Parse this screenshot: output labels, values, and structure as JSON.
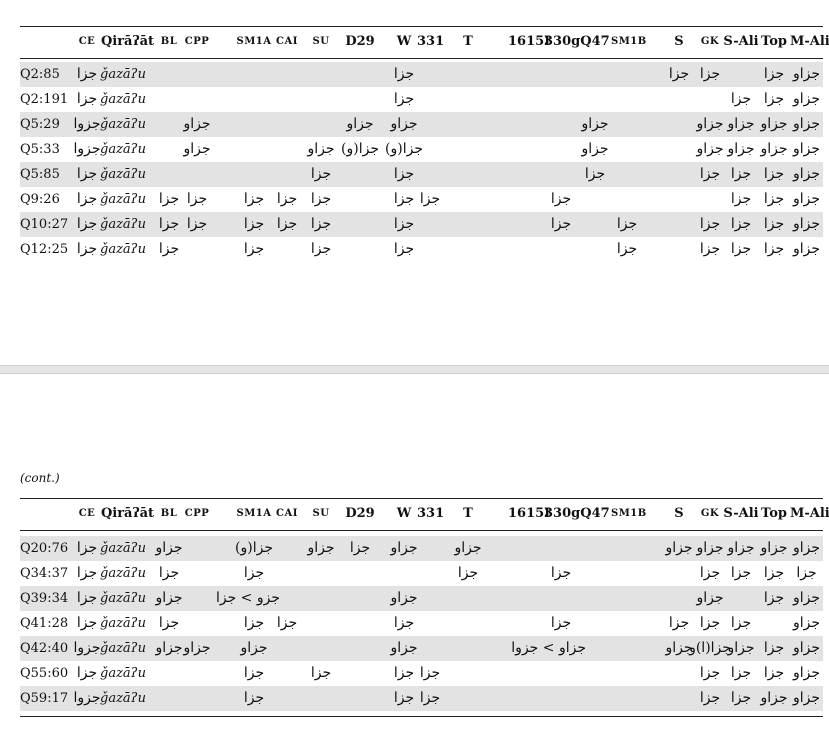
{
  "columns": [
    {
      "key": "ref",
      "label": ""
    },
    {
      "key": "ce",
      "label": "ce"
    },
    {
      "key": "qiraat",
      "label": "Qirāʔāt"
    },
    {
      "key": "bl",
      "label": "bl"
    },
    {
      "key": "cpp",
      "label": "cpp"
    },
    {
      "key": "sm1a",
      "label": "sm1a"
    },
    {
      "key": "cai",
      "label": "cai"
    },
    {
      "key": "su",
      "label": "su"
    },
    {
      "key": "d29",
      "label": "D29"
    },
    {
      "key": "w",
      "label": "W"
    },
    {
      "key": "c331",
      "label": "331"
    },
    {
      "key": "t",
      "label": "T"
    },
    {
      "key": "c1615",
      "label": "1615I"
    },
    {
      "key": "c330",
      "label": "330g"
    },
    {
      "key": "q47",
      "label": "Q47"
    },
    {
      "key": "sm1b",
      "label": "sm1b"
    },
    {
      "key": "s",
      "label": "S"
    },
    {
      "key": "gk",
      "label": "gk"
    },
    {
      "key": "sali",
      "label": "S-Ali"
    },
    {
      "key": "top",
      "label": "Top"
    },
    {
      "key": "mali",
      "label": "M-Ali"
    }
  ],
  "table1": {
    "rows": [
      {
        "ref": "Q2:85",
        "ce": "جزا",
        "qiraat": "ǧazāʔu",
        "w": "جزا",
        "s": "جزا",
        "gk": "جزا",
        "top": "جزا",
        "mali": "جزاو"
      },
      {
        "ref": "Q2:191",
        "ce": "جزا",
        "qiraat": "ǧazāʔu",
        "w": "جزا",
        "sali": "جزا",
        "top": "جزا",
        "mali": "جزاو"
      },
      {
        "ref": "Q5:29",
        "ce": "جزوا",
        "qiraat": "ǧazāʔu",
        "cpp": "جزاو",
        "d29": "جزاو",
        "w": "جزاو",
        "q47": "جزاو",
        "gk": "جزاو",
        "sali": "جزاو",
        "top": "جزاو",
        "mali": "جزاو"
      },
      {
        "ref": "Q5:33",
        "ce": "جزوا",
        "qiraat": "ǧazāʔu",
        "cpp": "جزاو",
        "su": "جزاو",
        "d29": "جزا(و)",
        "w": "جزا(و)",
        "q47": "جزاو",
        "gk": "جزاو",
        "sali": "جزاو",
        "top": "جزاو",
        "mali": "جزاو"
      },
      {
        "ref": "Q5:85",
        "ce": "جزا",
        "qiraat": "ǧazāʔu",
        "su": "جزا",
        "w": "جزا",
        "q47": "جزا",
        "gk": "جزا",
        "sali": "جزا",
        "top": "جزا",
        "mali": "جزاو"
      },
      {
        "ref": "Q9:26",
        "ce": "جزا",
        "qiraat": "ǧazāʔu",
        "bl": "جزا",
        "cpp": "جزا",
        "sm1a": "جزا",
        "cai": "جزا",
        "su": "جزا",
        "w": "جزا",
        "c331": "جزا",
        "c330": "جزا",
        "sali": "جزا",
        "top": "جزا",
        "mali": "جزاو"
      },
      {
        "ref": "Q10:27",
        "ce": "جزا",
        "qiraat": "ǧazāʔu",
        "bl": "جزا",
        "cpp": "جزا",
        "sm1a": "جزا",
        "cai": "جزا",
        "su": "جزا",
        "w": "جزا",
        "c330": "جزا",
        "sm1b": "جزا",
        "gk": "جزا",
        "sali": "جزا",
        "top": "جزا",
        "mali": "جزاو"
      },
      {
        "ref": "Q12:25",
        "ce": "جزا",
        "qiraat": "ǧazāʔu",
        "bl": "جزا",
        "sm1a": "جزا",
        "su": "جزا",
        "w": "جزا",
        "sm1b": "جزا",
        "gk": "جزا",
        "sali": "جزا",
        "top": "جزا",
        "mali": "جزاو"
      }
    ]
  },
  "continuation_label": "(cont.)",
  "table2": {
    "rows": [
      {
        "ref": "Q20:76",
        "ce": "جزا",
        "qiraat": "ǧazāʔu",
        "bl": "جزاو",
        "sm1a": "جزا(و)",
        "su": "جزاو",
        "d29": "جزا",
        "w": "جزاو",
        "t": "جزاو",
        "s": "جزاو",
        "gk": "جزاو",
        "sali": "جزاو",
        "top": "جزاو",
        "mali": "جزاو"
      },
      {
        "ref": "Q34:37",
        "ce": "جزا",
        "qiraat": "ǧazāʔu",
        "bl": "جزا",
        "sm1a": "جزا",
        "t": "جزا",
        "c330": "جزا",
        "gk": "جزا",
        "sali": "جزا",
        "top": "جزا",
        "mali": "جزا"
      },
      {
        "ref": "Q39:34",
        "ce": "جزا",
        "qiraat": "ǧazāʔu",
        "bl": "جزاو",
        "sm1a": "جزو > جزا",
        "w": "جزاو",
        "gk": "جزاو",
        "top": "جزا",
        "mali": "جزاو"
      },
      {
        "ref": "Q41:28",
        "ce": "جزا",
        "qiraat": "ǧazāʔu",
        "bl": "جزا",
        "sm1a": "جزا",
        "cai": "جزا",
        "w": "جزا",
        "c330": "جزا",
        "s": "جزا",
        "gk": "جزا",
        "sali": "جزا",
        "mali": "جزاو"
      },
      {
        "ref": "Q42:40",
        "ce": "جزوا",
        "qiraat": "ǧazāʔu",
        "bl": "جزاو",
        "cpp": "جزاو",
        "sm1a": "جزاو",
        "w": "جزاو",
        "c330": "جزاو > جزوا",
        "s": "جزاو",
        "gk": "جزا(ا)و",
        "sali": "جزاو",
        "top": "جزا",
        "mali": "جزاو"
      },
      {
        "ref": "Q55:60",
        "ce": "جزا",
        "qiraat": "ǧazāʔu",
        "sm1a": "جزا",
        "su": "جزا",
        "w": "جزا",
        "c331": "جزا",
        "gk": "جزا",
        "sali": "جزا",
        "top": "جزا",
        "mali": "جزاو"
      },
      {
        "ref": "Q59:17",
        "ce": "جزوا",
        "qiraat": "ǧazāʔu",
        "sm1a": "جزا",
        "w": "جزا",
        "c331": "جزا",
        "gk": "جزا",
        "sali": "جزا",
        "top": "جزاو",
        "mali": "جزاو"
      }
    ]
  }
}
